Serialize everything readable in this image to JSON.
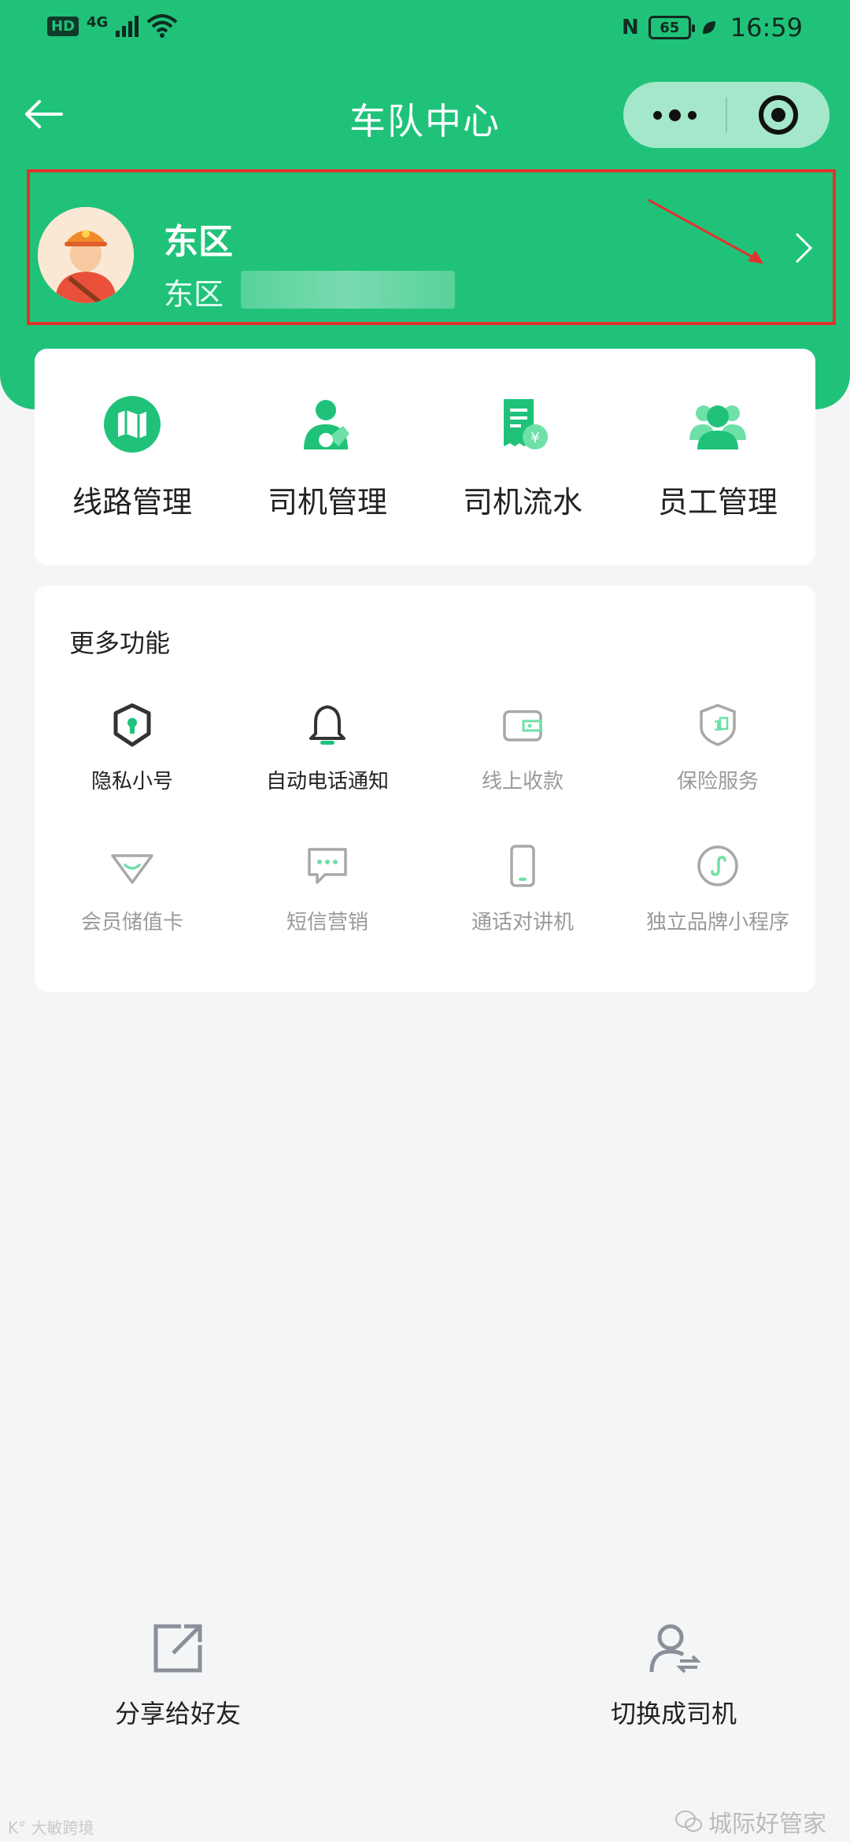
{
  "status_bar": {
    "hd": "HD",
    "network": "4G",
    "nfc": "N",
    "battery": "65",
    "time": "16:59"
  },
  "nav": {
    "title": "车队中心"
  },
  "profile": {
    "name": "东区",
    "subtitle": "东区"
  },
  "main_functions": [
    {
      "label": "线路管理",
      "icon": "map-icon"
    },
    {
      "label": "司机管理",
      "icon": "driver-icon"
    },
    {
      "label": "司机流水",
      "icon": "receipt-icon"
    },
    {
      "label": "员工管理",
      "icon": "staff-icon"
    }
  ],
  "more": {
    "title": "更多功能",
    "items": [
      {
        "label": "隐私小号",
        "icon": "shield-lock-icon",
        "enabled": true
      },
      {
        "label": "自动电话通知",
        "icon": "bell-icon",
        "enabled": true
      },
      {
        "label": "线上收款",
        "icon": "wallet-icon",
        "enabled": false
      },
      {
        "label": "保险服务",
        "icon": "insurance-icon",
        "enabled": false
      },
      {
        "label": "会员储值卡",
        "icon": "diamond-icon",
        "enabled": false
      },
      {
        "label": "短信营销",
        "icon": "sms-icon",
        "enabled": false
      },
      {
        "label": "通话对讲机",
        "icon": "phone-device-icon",
        "enabled": false
      },
      {
        "label": "独立品牌小程序",
        "icon": "mini-program-icon",
        "enabled": false
      }
    ]
  },
  "bottom": {
    "share_label": "分享给好友",
    "switch_label": "切换成司机"
  },
  "watermarks": {
    "left": "K° 大敏跨境",
    "right": "城际好管家"
  },
  "colors": {
    "primary": "#20c27a",
    "highlight_border": "#e0332c",
    "disabled_text": "#9a9a9a"
  }
}
